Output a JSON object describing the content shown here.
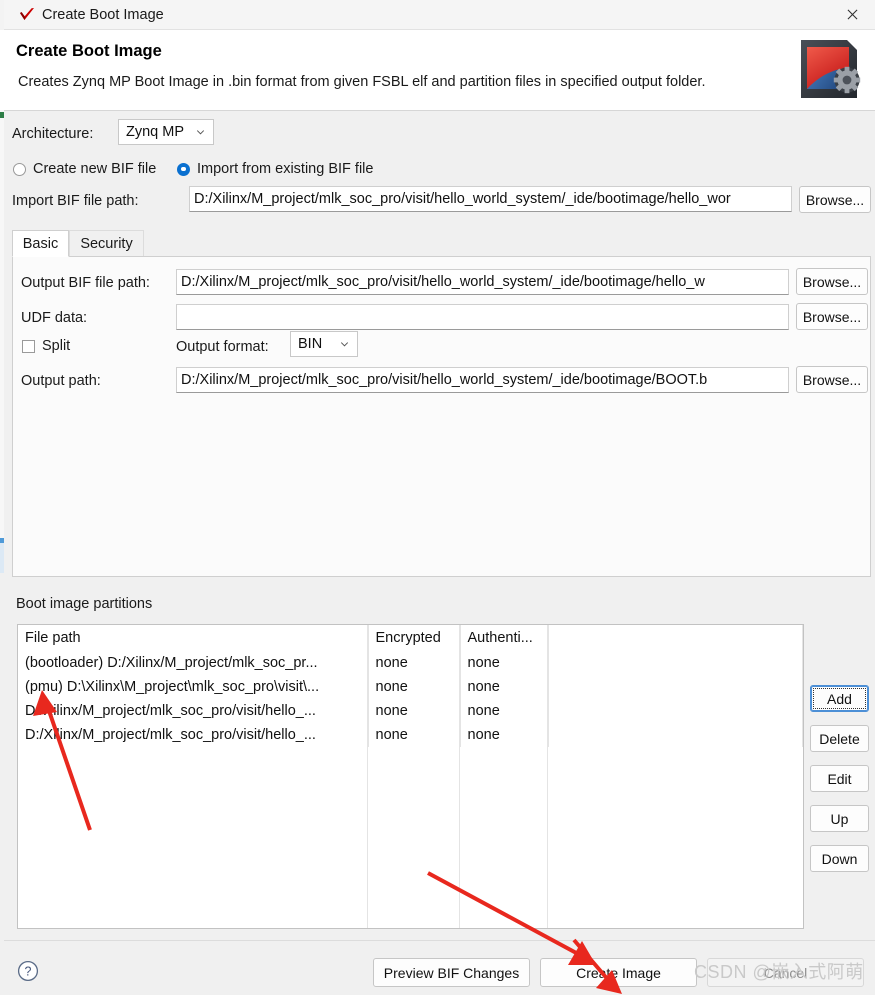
{
  "window": {
    "title": "Create Boot Image",
    "icon": "xilinx-checkmark-icon",
    "close_label": "✕"
  },
  "header": {
    "title": "Create Boot Image",
    "description": "Creates Zynq MP Boot Image in .bin format from given FSBL elf and partition files in specified output folder.",
    "logo": "boot-image-chip-gear-icon"
  },
  "form": {
    "architecture_label": "Architecture:",
    "architecture_value": "Zynq MP",
    "radio_create_new": "Create new BIF file",
    "radio_import_existing": "Import from existing BIF file",
    "selected_radio": "import",
    "import_bif_label": "Import BIF file path:",
    "import_bif_value": "D:/Xilinx/M_project/mlk_soc_pro/visit/hello_world_system/_ide/bootimage/hello_wor",
    "import_browse_label": "Browse..."
  },
  "tabs": [
    {
      "label": "Basic",
      "active": true
    },
    {
      "label": "Security",
      "active": false
    }
  ],
  "basic_tab": {
    "output_bif_label": "Output BIF file path:",
    "output_bif_value": "D:/Xilinx/M_project/mlk_soc_pro/visit/hello_world_system/_ide/bootimage/hello_w",
    "output_bif_browse": "Browse...",
    "udf_label": "UDF data:",
    "udf_value": "",
    "udf_browse": "Browse...",
    "split_label": "Split",
    "split_checked": false,
    "output_format_label": "Output format:",
    "output_format_value": "BIN",
    "output_path_label": "Output path:",
    "output_path_value": "D:/Xilinx/M_project/mlk_soc_pro/visit/hello_world_system/_ide/bootimage/BOOT.b",
    "output_path_browse": "Browse..."
  },
  "partitions": {
    "group_title": "Boot image partitions",
    "columns": [
      "File path",
      "Encrypted",
      "Authenti..."
    ],
    "rows": [
      {
        "file_path": "(bootloader) D:/Xilinx/M_project/mlk_soc_pr...",
        "encrypted": "none",
        "authentication": "none"
      },
      {
        "file_path": "(pmu) D:\\Xilinx\\M_project\\mlk_soc_pro\\visit\\...",
        "encrypted": "none",
        "authentication": "none"
      },
      {
        "file_path": "D:/Xilinx/M_project/mlk_soc_pro/visit/hello_...",
        "encrypted": "none",
        "authentication": "none"
      },
      {
        "file_path": "D:/Xilinx/M_project/mlk_soc_pro/visit/hello_...",
        "encrypted": "none",
        "authentication": "none"
      }
    ],
    "side_buttons": [
      {
        "label": "Add",
        "focused": true
      },
      {
        "label": "Delete",
        "focused": false
      },
      {
        "label": "Edit",
        "focused": false
      },
      {
        "label": "Up",
        "focused": false
      },
      {
        "label": "Down",
        "focused": false
      }
    ]
  },
  "footer": {
    "help_icon": "help-question-icon",
    "preview_label": "Preview BIF Changes",
    "create_label": "Create Image",
    "cancel_label": "Cancel"
  },
  "watermark": {
    "text": "CSDN @嵌入式阿萌"
  },
  "colors": {
    "accent": "#0a70d0",
    "annotation": "#e8281e",
    "dialog_bg": "#f0f0f0",
    "panel_bg": "#fbfbfb"
  }
}
